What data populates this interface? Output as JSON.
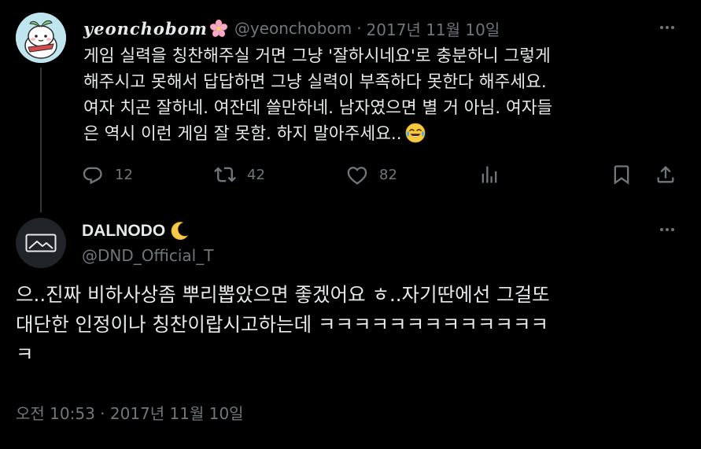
{
  "post1": {
    "display_name": "yeonchobom",
    "handle": "@yeonchobom",
    "separator": "·",
    "date": "2017년 11월 10일",
    "body_lines": [
      "게임 실력을 칭찬해주실 거면 그냥 '잘하시네요'로 충분하니 그렇게",
      "해주시고 못해서 답답하면 그냥 실력이 부족하다 못한다 해주세요.",
      "여자 치곤 잘하네. 여잔데 쓸만하네. 남자였으면 별 거 아님. 여자들",
      "은 역시 이런 게임 잘 못함. 하지 말아주세요.."
    ],
    "actions": {
      "replies": "12",
      "retweets": "42",
      "likes": "82"
    },
    "icons": {
      "name_emoji": "cherry-blossom-icon",
      "body_emoji": "face-with-tears-of-joy-icon",
      "more": "more-dots-icon",
      "reply": "reply-icon",
      "retweet": "retweet-icon",
      "like": "heart-icon",
      "views": "analytics-icon",
      "bookmark": "bookmark-icon",
      "share": "share-icon"
    }
  },
  "post2": {
    "display_name": "DALNODO",
    "handle": "@DND_Official_T",
    "body_lines": [
      "으..진짜 비하사상좀 뿌리뽑았으면 좋겠어요 ㅎ..자기딴에선 그걸또",
      "대단한 인정이나 칭찬이랍시고하는데 ㅋㅋㅋㅋㅋㅋㅋㅋㅋㅋㅋㅋㅋ",
      "ㅋ"
    ],
    "timestamp": "오전 10:53 · 2017년 11월 10일",
    "icons": {
      "name_emoji": "crescent-moon-icon",
      "more": "more-dots-icon"
    }
  },
  "colors": {
    "background": "#000000",
    "text_primary": "#e7e9ea",
    "text_secondary": "#71767b",
    "thread_line": "#333639"
  }
}
